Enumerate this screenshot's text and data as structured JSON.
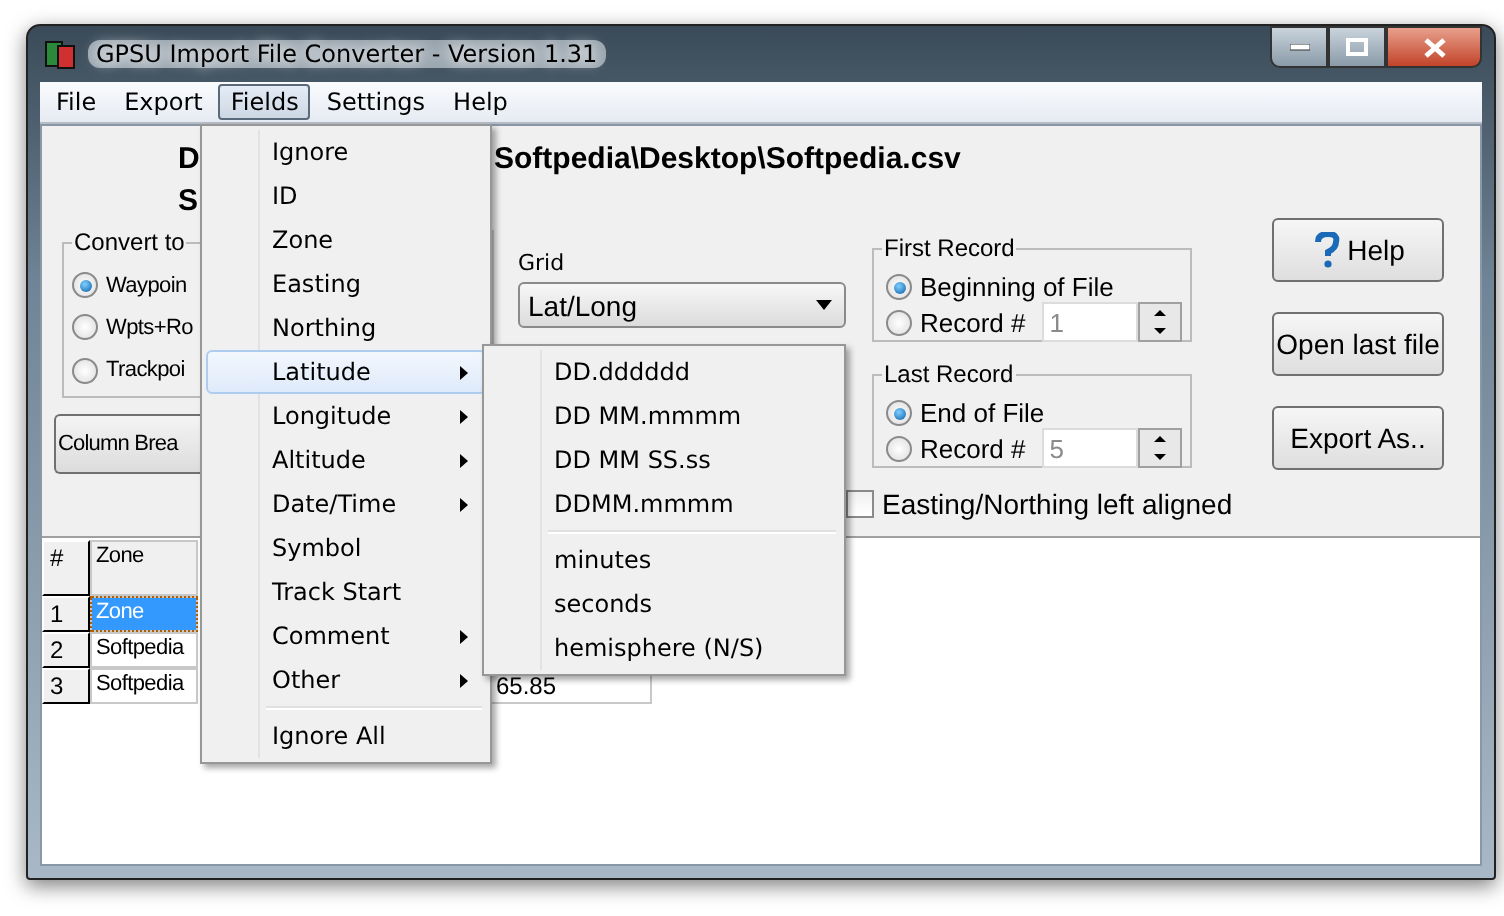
{
  "window": {
    "title": "GPSU Import File Converter - Version 1.31"
  },
  "menu_bar": [
    {
      "label": "File",
      "selected": false
    },
    {
      "label": "Export",
      "selected": false
    },
    {
      "label": "Fields",
      "selected": true
    },
    {
      "label": "Settings",
      "selected": false
    },
    {
      "label": "Help",
      "selected": false
    }
  ],
  "file_info": {
    "labels": [
      "D",
      "S"
    ],
    "path": "Softpedia\\Desktop\\Softpedia.csv"
  },
  "convert_to": {
    "title": "Convert to",
    "options": [
      {
        "label": "Waypoin",
        "selected": true
      },
      {
        "label": "Wpts+Ro",
        "selected": false
      },
      {
        "label": "Trackpoi",
        "selected": false
      }
    ]
  },
  "column_break_button": "Column Brea",
  "grid": {
    "label": "Grid",
    "value": "Lat/Long"
  },
  "first_record": {
    "title": "First Record",
    "options": [
      {
        "label": "Beginning of File",
        "selected": true
      },
      {
        "label": "Record #",
        "selected": false,
        "value": "1"
      }
    ]
  },
  "last_record": {
    "title": "Last Record",
    "options": [
      {
        "label": "End of File",
        "selected": true
      },
      {
        "label": "Record #",
        "selected": false,
        "value": "5"
      }
    ]
  },
  "buttons": [
    {
      "label": "Help",
      "kind": "help"
    },
    {
      "label": "Open last file",
      "kind": "plain"
    },
    {
      "label": "Export As..",
      "kind": "plain"
    }
  ],
  "easting_left_aligned": {
    "label": "Easting/Northing left aligned",
    "checked": false
  },
  "table": {
    "columns": [
      "#",
      "Zone"
    ],
    "rows": [
      {
        "cells": [
          "1",
          "Zone"
        ],
        "selected": true
      },
      {
        "cells": [
          "2",
          "Softpedia"
        ],
        "selected": false
      },
      {
        "cells": [
          "3",
          "Softpedia",
          "65.85"
        ],
        "selected": false
      }
    ]
  },
  "fields_menu": {
    "items": [
      {
        "label": "Ignore",
        "kind": "item",
        "selected": false
      },
      {
        "label": "ID",
        "kind": "item",
        "selected": false
      },
      {
        "label": "Zone",
        "kind": "item",
        "selected": false
      },
      {
        "label": "Easting",
        "kind": "item",
        "selected": false
      },
      {
        "label": "Northing",
        "kind": "item",
        "selected": false
      },
      {
        "label": "Latitude",
        "kind": "submenu",
        "selected": true
      },
      {
        "label": "Longitude",
        "kind": "submenu",
        "selected": false
      },
      {
        "label": "Altitude",
        "kind": "submenu",
        "selected": false
      },
      {
        "label": "Date/Time",
        "kind": "submenu",
        "selected": false
      },
      {
        "label": "Symbol",
        "kind": "item",
        "selected": false
      },
      {
        "label": "Track Start",
        "kind": "item",
        "selected": false
      },
      {
        "label": "Comment",
        "kind": "submenu",
        "selected": false
      },
      {
        "label": "Other",
        "kind": "submenu",
        "selected": false
      },
      {
        "kind": "separator"
      },
      {
        "label": "Ignore All",
        "kind": "item",
        "selected": false
      }
    ]
  },
  "latitude_submenu": {
    "items": [
      {
        "label": "DD.dddddd",
        "kind": "item"
      },
      {
        "label": "DD MM.mmmm",
        "kind": "item"
      },
      {
        "label": "DD MM SS.ss",
        "kind": "item"
      },
      {
        "label": "DDMM.mmmm",
        "kind": "item"
      },
      {
        "kind": "separator"
      },
      {
        "label": "minutes",
        "kind": "item"
      },
      {
        "label": "seconds",
        "kind": "item"
      },
      {
        "label": "hemisphere (N/S)",
        "kind": "item"
      }
    ]
  }
}
